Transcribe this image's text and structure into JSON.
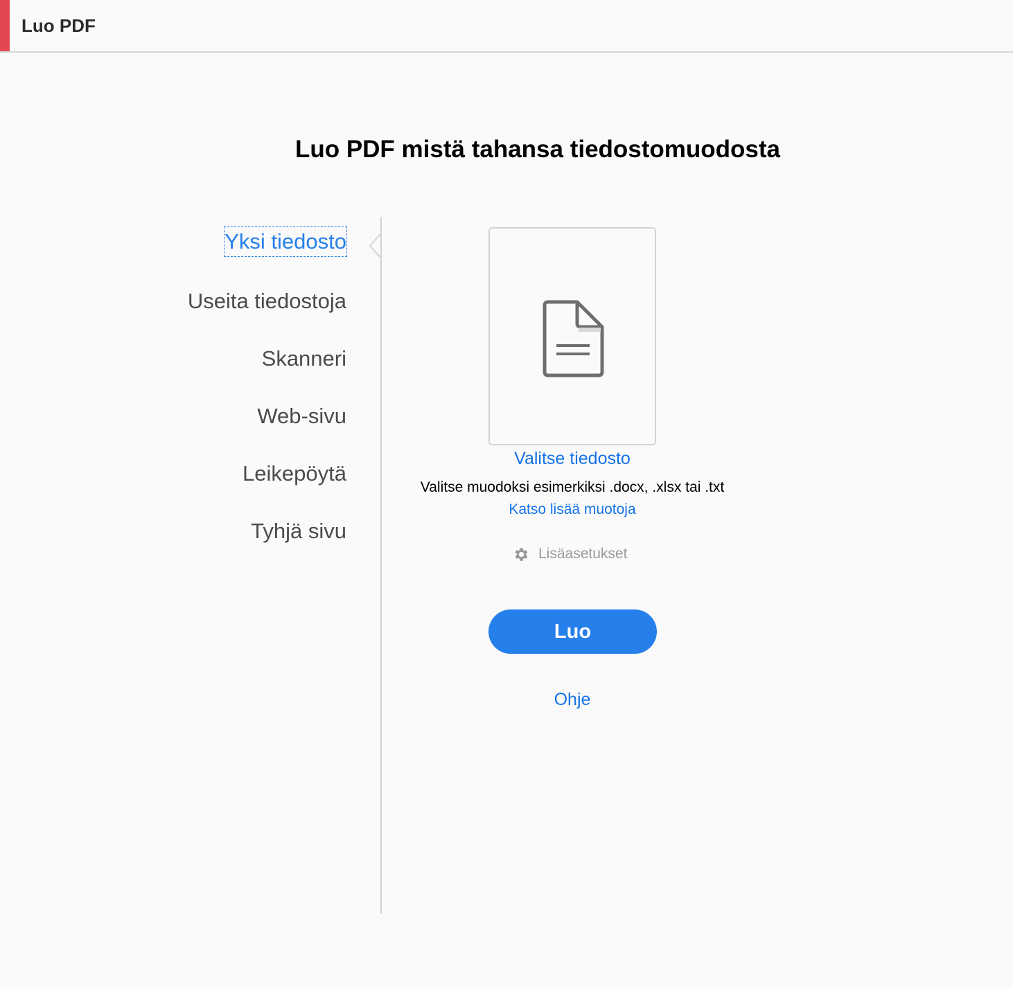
{
  "header": {
    "title": "Luo PDF",
    "accent_color": "#e34850"
  },
  "main": {
    "title": "Luo PDF mistä tahansa tiedostomuodosta"
  },
  "nav": {
    "active_index": 0,
    "items": [
      {
        "label": "Yksi tiedosto"
      },
      {
        "label": "Useita tiedostoja"
      },
      {
        "label": "Skanneri"
      },
      {
        "label": "Web-sivu"
      },
      {
        "label": "Leikepöytä"
      },
      {
        "label": "Tyhjä sivu"
      }
    ]
  },
  "content": {
    "file_icon": "document-icon",
    "choose_file_label": "Valitse tiedosto",
    "formats_text": "Valitse muodoksi esimerkiksi .docx, .xlsx tai .txt",
    "more_formats_label": "Katso lisää muotoja",
    "settings_icon": "gear-icon",
    "settings_label": "Lisäasetukset",
    "create_button_label": "Luo",
    "help_label": "Ohje"
  },
  "colors": {
    "link": "#1473e6",
    "primary_button": "#2680eb",
    "active_nav": "#2680eb"
  }
}
